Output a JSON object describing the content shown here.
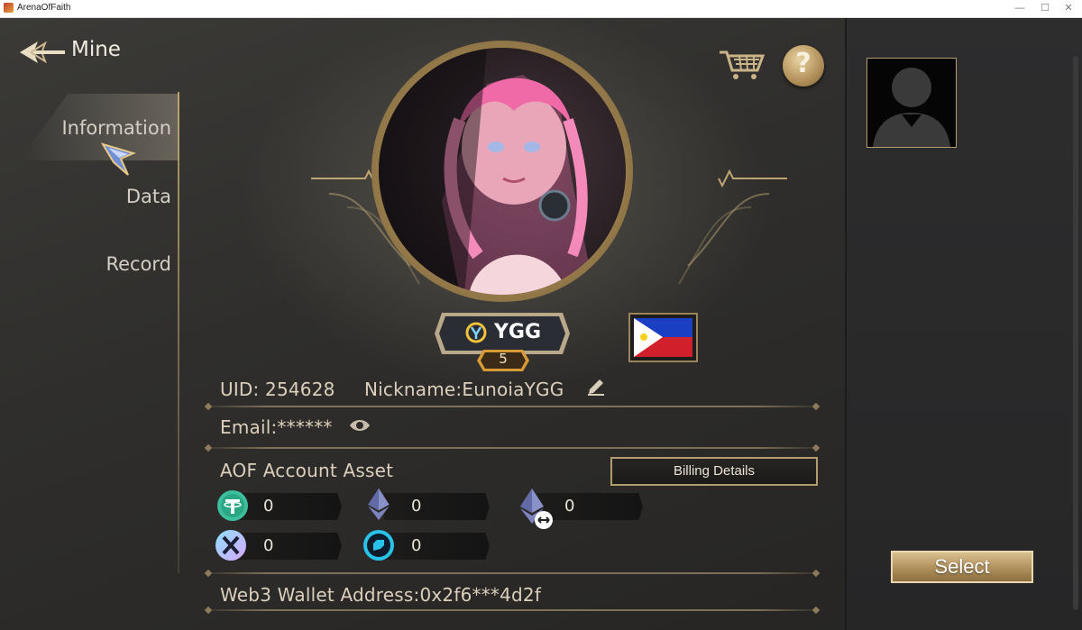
{
  "window": {
    "title": "ArenaOfFaith",
    "minimize": "—",
    "maximize": "☐",
    "close": "✕"
  },
  "header": {
    "title": "Mine"
  },
  "nav": {
    "information": "Information",
    "data": "Data",
    "record": "Record"
  },
  "profile": {
    "badge_name": "YGG",
    "level": "5",
    "uid_text": "UID: 254628",
    "nickname_text": "Nickname:EunoiaYGG",
    "email_text": "Email:******"
  },
  "assets": {
    "title": "AOF Account Asset",
    "billing_label": "Billing Details",
    "usdt": "0",
    "eth": "0",
    "bridged_eth": "0",
    "immutable_x": "0",
    "fist": "0"
  },
  "wallet": {
    "text": "Web3 Wallet Address:0x2f6***4d2f"
  },
  "side": {
    "select_label": "Select"
  },
  "colors": {
    "gold": "#b39460",
    "text": "#dccfbb",
    "panel": "#2d2d2e"
  }
}
